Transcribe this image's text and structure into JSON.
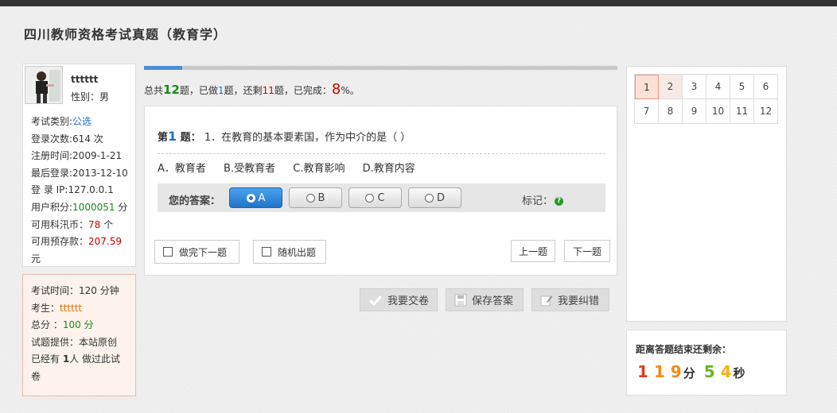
{
  "page": {
    "title": "四川教师资格考试真题（教育学）"
  },
  "profile": {
    "name": "tttttt",
    "gender": "性别：男",
    "exam_type_label": "考试类别:",
    "exam_type_value": "公选",
    "login_count": "登录次数:614 次",
    "register_time": "注册时间:2009-1-21",
    "last_login": "最后登录:2013-12-10",
    "login_ip": "登 录  IP:127.0.0.1",
    "points_label": "用户积分:",
    "points_value": "1000051",
    "points_unit": " 分",
    "coins_label": "可用科汛币：",
    "coins_value": "78",
    "coins_unit": " 个",
    "deposit_label": "可用预存款：",
    "deposit_value": "207.59",
    "deposit_unit": "元"
  },
  "exam_info": {
    "time": "考试时间：120 分钟",
    "examinee_label": "考生：",
    "examinee_value": "tttttt",
    "score_label": "总分 ：",
    "score_value": "100 分",
    "provider": "试题提供：本站原创",
    "taken_prefix": "已经有 ",
    "taken_count": "1",
    "taken_suffix": "人 做过此试卷"
  },
  "progress": {
    "fraction": 0.08,
    "prefix": "总共",
    "total": "12",
    "mid1": "题，已做",
    "done": "1",
    "mid2": "题，还剩",
    "remaining": "11",
    "mid3": "题，已完成：",
    "percent": "8",
    "suffix": "%。"
  },
  "question": {
    "prefix": "第",
    "number": "1",
    "suffix": " 题：",
    "text": " 1．在教育的基本要素国，作为中介的是（    ）",
    "options": [
      "A．教育者",
      "B.受教育者",
      "C.教育影响",
      "D.教育内容"
    ],
    "answer_label": "您的答案：",
    "choices": [
      "A",
      "B",
      "C",
      "D"
    ],
    "selected": "A",
    "mark_label": "标记：",
    "mark_icon": "question-mark-icon"
  },
  "controls": {
    "auto_next": "做完下一题",
    "random": "随机出题",
    "prev": "上一题",
    "next": "下一题"
  },
  "actions": {
    "submit": "我要交卷",
    "save": "保存答案",
    "report": "我要纠错"
  },
  "question_grid": {
    "numbers": [
      "1",
      "2",
      "3",
      "4",
      "5",
      "6",
      "7",
      "8",
      "9",
      "10",
      "11",
      "12"
    ],
    "current": "1"
  },
  "timer": {
    "label": "距离答题结束还剩余：",
    "min_digits": [
      "1",
      "1",
      "9"
    ],
    "min_unit": "分",
    "sec_digits": [
      "5",
      "4"
    ],
    "sec_unit": "秒"
  },
  "colors": {
    "accent_blue": "#2273c7",
    "progress_blue": "#4a90d9",
    "red": "#cc0000",
    "green": "#1a8a1a"
  }
}
